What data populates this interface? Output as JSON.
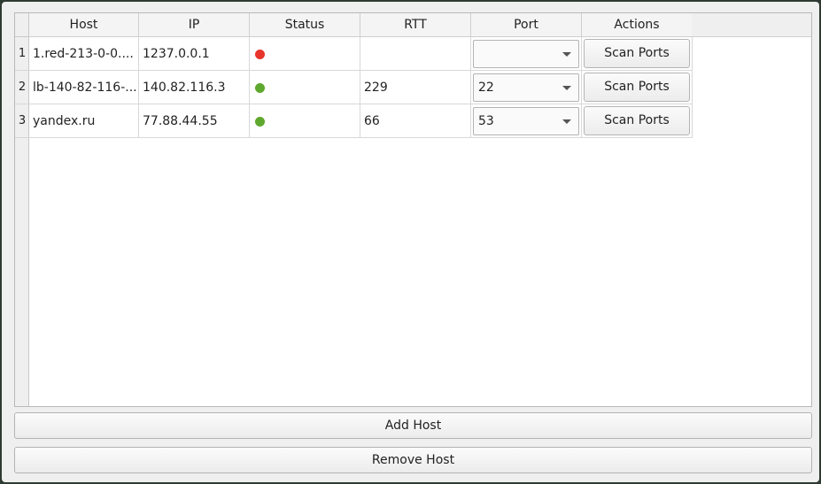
{
  "table": {
    "columns": [
      "Host",
      "IP",
      "Status",
      "RTT",
      "Port",
      "Actions"
    ],
    "rows": [
      {
        "num": "1",
        "host": "1.red-213-0-0....",
        "ip": "1237.0.0.1",
        "status": "offline",
        "status_color": "#e8352b",
        "rtt": "",
        "port": "",
        "action": "Scan Ports"
      },
      {
        "num": "2",
        "host": "lb-140-82-116-...",
        "ip": "140.82.116.3",
        "status": "online",
        "status_color": "#5fa82e",
        "rtt": "229",
        "port": "22",
        "action": "Scan Ports"
      },
      {
        "num": "3",
        "host": "yandex.ru",
        "ip": "77.88.44.55",
        "status": "online",
        "status_color": "#5fa82e",
        "rtt": "66",
        "port": "53",
        "action": "Scan Ports"
      }
    ]
  },
  "buttons": {
    "add_host": "Add Host",
    "remove_host": "Remove Host"
  }
}
